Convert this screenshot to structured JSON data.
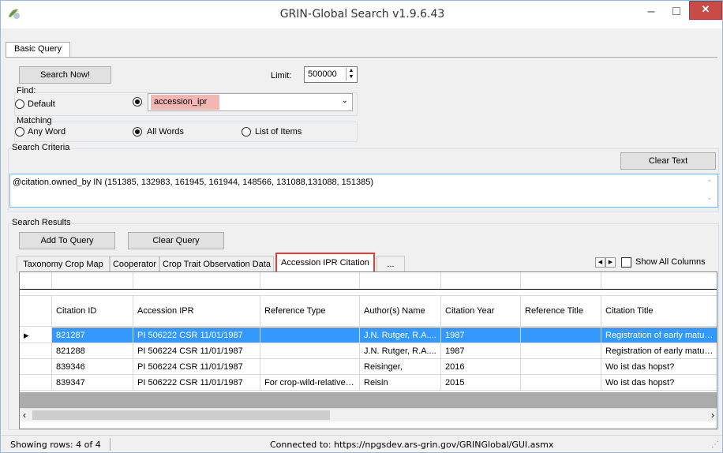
{
  "window": {
    "title": "GRIN-Global Search v1.9.6.43",
    "minimize": "–",
    "maximize": "□",
    "close": "✕"
  },
  "main_tab": "Basic Query",
  "search_now": "Search Now!",
  "limit": {
    "label": "Limit:",
    "value": "500000"
  },
  "find": {
    "legend": "Find:",
    "default_label": "Default",
    "selected_value": "accession_ipr"
  },
  "matching": {
    "legend": "Matching",
    "options": [
      "Any Word",
      "All Words",
      "List of Items"
    ],
    "selected": "All Words"
  },
  "criteria": {
    "legend": "Search Criteria",
    "clear_text": "Clear Text",
    "text": "@citation.owned_by IN (151385, 132983, 161945, 161944, 148566, 131088,131088, 151385)"
  },
  "results": {
    "legend": "Search Results",
    "add_to_query": "Add To Query",
    "clear_query": "Clear Query",
    "tabs": [
      "Taxonomy Crop Map",
      "Cooperator",
      "Crop Trait Observation Data",
      "Accession IPR Citation",
      "..."
    ],
    "active_tab": "Accession IPR Citation",
    "show_all_columns": "Show All Columns",
    "columns": [
      "Citation ID",
      "Accession IPR",
      "Reference Type",
      "Author(s) Name",
      "Citation Year",
      "Reference Title",
      "Citation Title"
    ],
    "rows": [
      [
        "821287",
        "PI 506222 CSR 11/01/1987",
        "",
        "J.N. Rutger, R.A....",
        "1987",
        "",
        "Registration of early maturing..."
      ],
      [
        "821288",
        "PI 506224 CSR 11/01/1987",
        "",
        "J.N. Rutger, R.A....",
        "1987",
        "",
        "Registration of early maturing..."
      ],
      [
        "839346",
        "PI 506224 CSR 11/01/1987",
        "",
        "Reisinger,",
        "2016",
        "",
        "Wo ist das hopst?"
      ],
      [
        "839347",
        "PI 506222 CSR 11/01/1987",
        "For crop-wild-relative r...",
        "Reisin",
        "2015",
        "",
        "Wo ist das hopst?"
      ]
    ],
    "selected_row": 0
  },
  "status": {
    "rows": "Showing rows: 4 of 4",
    "connection": "Connected to: https://npgsdev.ars-grin.gov/GRINGlobal/GUI.asmx"
  }
}
